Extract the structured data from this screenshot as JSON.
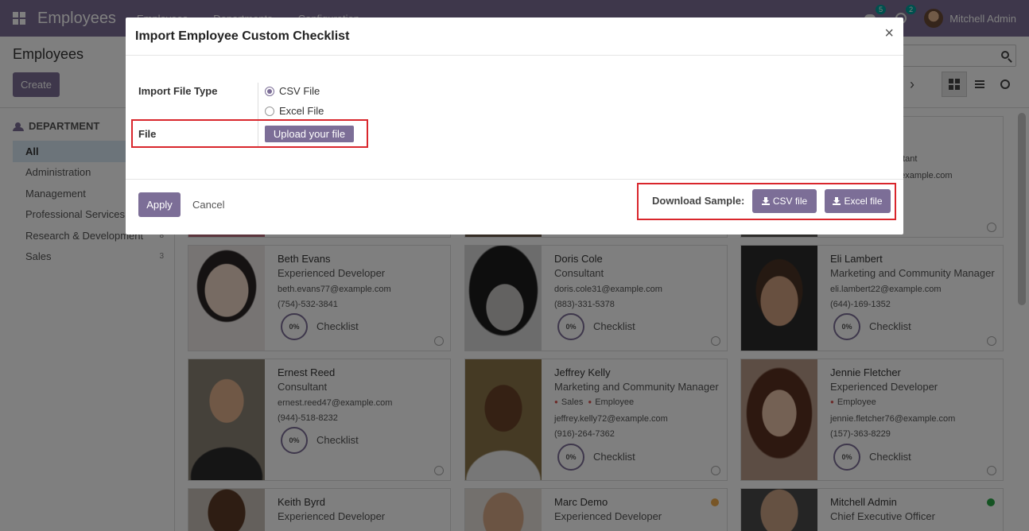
{
  "navbar": {
    "app_title": "Employees",
    "menu": [
      "Employees",
      "Departments",
      "Configuration"
    ],
    "messages_badge": "5",
    "activities_badge": "2",
    "user_name": "Mitchell Admin"
  },
  "control_panel": {
    "breadcrumb": "Employees",
    "create_label": "Create"
  },
  "sidebar": {
    "heading": "DEPARTMENT",
    "items": [
      {
        "label": "All",
        "count": ""
      },
      {
        "label": "Administration",
        "count": ""
      },
      {
        "label": "Management",
        "count": ""
      },
      {
        "label": "Professional Services",
        "count": ""
      },
      {
        "label": "Research & Development",
        "count": "8"
      },
      {
        "label": "Sales",
        "count": "3"
      }
    ]
  },
  "top_cards": {
    "right_name_partial": "n",
    "right_job_partial": "sultant",
    "right_email_partial": "@example.com"
  },
  "cards": [
    {
      "name": "Beth Evans",
      "job": "Experienced Developer",
      "tags": [],
      "email": "beth.evans77@example.com",
      "phone": "(754)-532-3841",
      "progress": "0%",
      "checklist": "Checklist"
    },
    {
      "name": "Doris Cole",
      "job": "Consultant",
      "tags": [],
      "email": "doris.cole31@example.com",
      "phone": "(883)-331-5378",
      "progress": "0%",
      "checklist": "Checklist"
    },
    {
      "name": "Eli Lambert",
      "job": "Marketing and Community Manager",
      "tags": [],
      "email": "eli.lambert22@example.com",
      "phone": "(644)-169-1352",
      "progress": "0%",
      "checklist": "Checklist"
    },
    {
      "name": "Ernest Reed",
      "job": "Consultant",
      "tags": [],
      "email": "ernest.reed47@example.com",
      "phone": "(944)-518-8232",
      "progress": "0%",
      "checklist": "Checklist"
    },
    {
      "name": "Jeffrey Kelly",
      "job": "Marketing and Community Manager",
      "tags": [
        "Sales",
        "Employee"
      ],
      "email": "jeffrey.kelly72@example.com",
      "phone": "(916)-264-7362",
      "progress": "0%",
      "checklist": "Checklist"
    },
    {
      "name": "Jennie Fletcher",
      "job": "Experienced Developer",
      "tags": [
        "Employee"
      ],
      "email": "jennie.fletcher76@example.com",
      "phone": "(157)-363-8229",
      "progress": "0%",
      "checklist": "Checklist"
    },
    {
      "name": "Keith Byrd",
      "job": "Experienced Developer",
      "tags": [],
      "email": "",
      "phone": "",
      "progress": "",
      "checklist": ""
    },
    {
      "name": "Marc Demo",
      "job": "Experienced Developer",
      "tags": [],
      "email": "",
      "phone": "",
      "progress": "",
      "checklist": ""
    },
    {
      "name": "Mitchell Admin",
      "job": "Chief Executive Officer",
      "tags": [],
      "email": "",
      "phone": "",
      "progress": "",
      "checklist": ""
    }
  ],
  "modal": {
    "title": "Import Employee Custom Checklist",
    "close_symbol": "×",
    "file_type_label": "Import File Type",
    "options": [
      "CSV File",
      "Excel File"
    ],
    "selected_option": "CSV File",
    "file_label": "File",
    "upload_label": "Upload your file",
    "apply_label": "Apply",
    "cancel_label": "Cancel",
    "download_label": "Download Sample:",
    "csv_button_label": "CSV file",
    "excel_button_label": "Excel file",
    "highlight_color": "#d9262c",
    "accent_color": "#7c6e97"
  }
}
